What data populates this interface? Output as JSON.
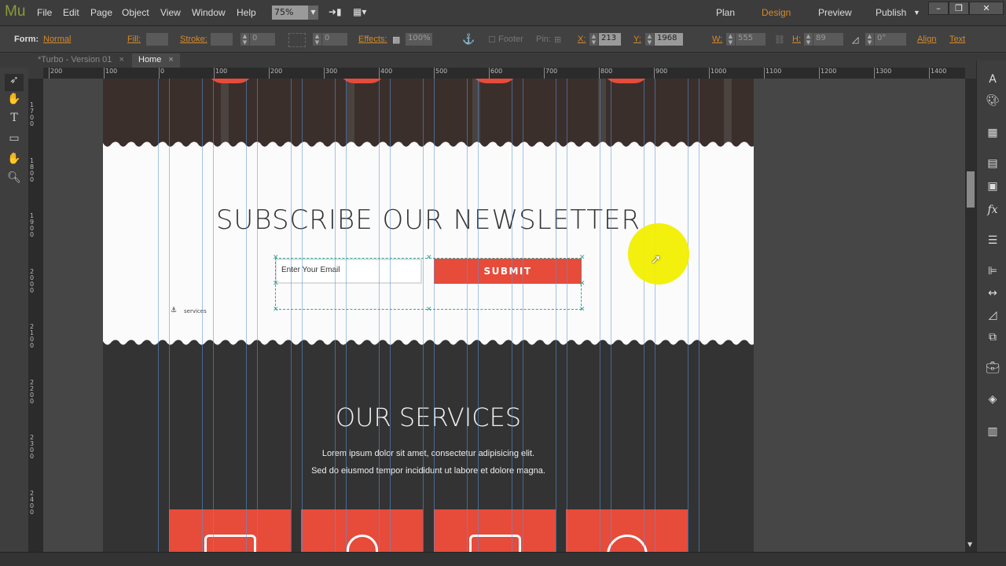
{
  "app": {
    "logo": "Mu"
  },
  "menu": [
    "File",
    "Edit",
    "Page",
    "Object",
    "View",
    "Window",
    "Help"
  ],
  "zoom": "75%",
  "workspaces": [
    {
      "label": "Plan"
    },
    {
      "label": "Design",
      "active": true
    },
    {
      "label": "Preview"
    },
    {
      "label": "Publish"
    }
  ],
  "window_buttons": [
    "–",
    "❐",
    "✕"
  ],
  "toolbar": {
    "form_label": "Form:",
    "form_value": "Normal",
    "fill": "Fill:",
    "stroke": "Stroke:",
    "stroke_w": "0",
    "radius": "0",
    "effects": "Effects:",
    "opacity": "100%",
    "footer": "Footer",
    "pin": "Pin:",
    "x_label": "X:",
    "x": "213",
    "y_label": "Y:",
    "y": "1968",
    "w_label": "W:",
    "w": "555",
    "h_label": "H:",
    "h": "89",
    "rot": "0°",
    "align": "Align",
    "text": "Text"
  },
  "tabs": [
    {
      "label": "*Turbo - Version 01"
    },
    {
      "label": "Home",
      "active": true
    }
  ],
  "hruler": [
    "200",
    "100",
    "0",
    "100",
    "200",
    "300",
    "400",
    "500",
    "600",
    "700",
    "800",
    "900",
    "1000",
    "1100",
    "1200",
    "1300",
    "1400"
  ],
  "vruler": [
    "1700",
    "1800",
    "1900",
    "2000",
    "2100",
    "2200",
    "2300",
    "2400"
  ],
  "page": {
    "newsletter_title": "SUBSCRIBE OUR NEWSLETTER",
    "email_placeholder": "Enter Your Email",
    "submit": "SUBMIT",
    "anchor_label": "services",
    "services_title": "OUR SERVICES",
    "services_line1": "Lorem ipsum dolor sit amet, consectetur adipisicing elit.",
    "services_line2": "Sed do eiusmod tempor incididunt ut labore et dolore magna."
  },
  "colors": {
    "accent": "#e74b3a",
    "workspace_active": "#d58a2a",
    "selection": "#2fa39a"
  }
}
